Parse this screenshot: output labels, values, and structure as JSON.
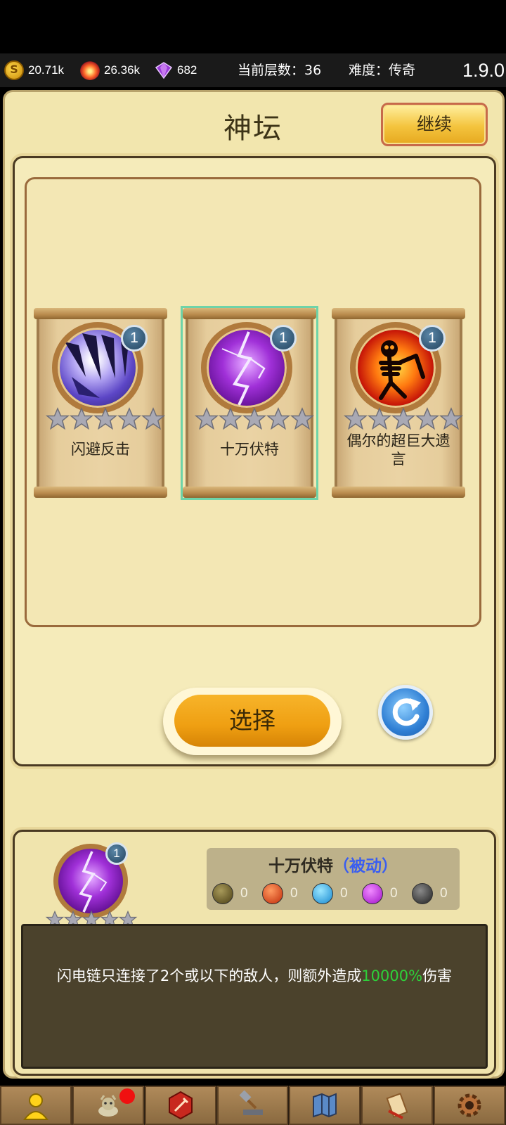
{
  "status": {
    "gold": "20.71k",
    "fire": "26.36k",
    "gems": "682",
    "level_label": "当前层数：",
    "level_value": "36",
    "difficulty_label": "难度：",
    "difficulty_value": "传奇",
    "version": "1.9.0"
  },
  "header": {
    "title": "神坛",
    "continue_label": "继续"
  },
  "cards": [
    {
      "name": "闪避反击",
      "level": "1",
      "stars": 5,
      "icon": "claw-icon",
      "selected": false
    },
    {
      "name": "十万伏特",
      "level": "1",
      "stars": 5,
      "icon": "lightning-icon",
      "selected": true
    },
    {
      "name": "偶尔的超巨大遗言",
      "level": "1",
      "stars": 5,
      "icon": "skeleton-icon",
      "selected": false
    }
  ],
  "actions": {
    "select_label": "选择",
    "refresh_icon": "refresh-icon"
  },
  "detail": {
    "name": "十万伏特",
    "type": "（被动）",
    "level": "1",
    "elements": [
      {
        "color": "#6b5a1e",
        "count": "0"
      },
      {
        "color": "#e8481c",
        "count": "0"
      },
      {
        "color": "#27a8e8",
        "count": "0"
      },
      {
        "color": "#c81ee0",
        "count": "0"
      },
      {
        "color": "#3a3a3a",
        "count": "0"
      }
    ],
    "description_prefix": "闪电链只连接了2个或以下的敌人，则额外造成",
    "description_highlight": "10000%",
    "description_suffix": "伤害"
  },
  "nav": [
    "hero-icon",
    "pet-icon",
    "equipment-icon",
    "forge-icon",
    "map-icon",
    "scroll-icon",
    "settings-icon"
  ],
  "colors": {
    "panel": "#f2e6ae",
    "accent_orange": "#ef9f12",
    "highlight_green": "#2ed03a",
    "type_blue": "#3a5ef0"
  }
}
